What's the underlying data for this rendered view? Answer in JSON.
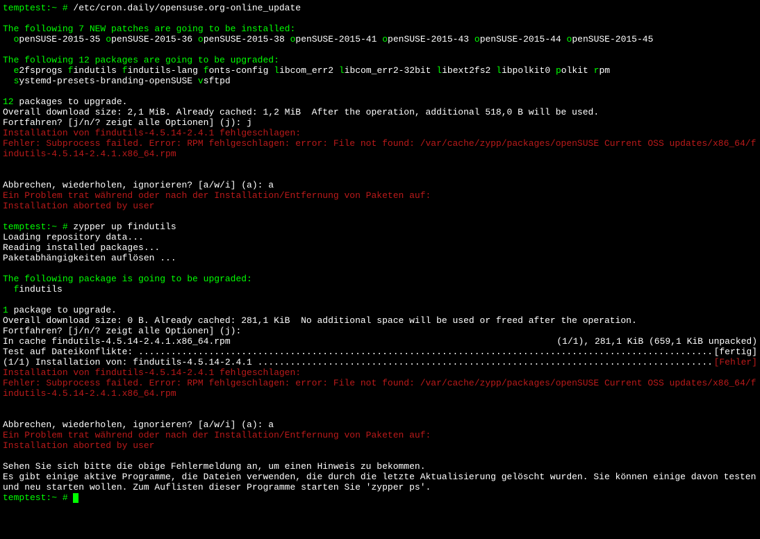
{
  "prompt1": {
    "host": "temptest:~ # ",
    "cmd": "/etc/cron.daily/opensuse.org-online_update"
  },
  "blank": "",
  "patches_header": "The following 7 NEW patches are going to be installed:",
  "patches": [
    "openSUSE-2015-35",
    "openSUSE-2015-36",
    "openSUSE-2015-38",
    "openSUSE-2015-41",
    "openSUSE-2015-43",
    "openSUSE-2015-44",
    "openSUSE-2015-45"
  ],
  "upgrades_header": "The following 12 packages are going to be upgraded:",
  "upgrades": [
    "e2fsprogs",
    "findutils",
    "findutils-lang",
    "fonts-config",
    "libcom_err2",
    "libcom_err2-32bit",
    "libext2fs2",
    "libpolkit0",
    "polkit",
    "rpm",
    "systemd-presets-branding-openSUSE",
    "vsftpd"
  ],
  "summary12": {
    "count": "12",
    "rest": " packages to upgrade."
  },
  "download1": "Overall download size: 2,1 MiB. Already cached: 1,2 MiB  After the operation, additional 518,0 B will be used.",
  "fortfahren1": "Fortfahren? [j/n/? zeigt alle Optionen] (j): j",
  "fail1a": "Installation von findutils-4.5.14-2.4.1 fehlgeschlagen:",
  "fail1b": "Fehler: Subprocess failed. Error: RPM fehlgeschlagen: error: File not found: /var/cache/zypp/packages/openSUSE Current OSS updates/x86_64/findutils-4.5.14-2.4.1.x86_64.rpm",
  "abbrechen": "Abbrechen, wiederholen, ignorieren? [a/w/i] (a): a",
  "problem": "Ein Problem trat während oder nach der Installation/Entfernung von Paketen auf:",
  "aborted": "Installation aborted by user",
  "prompt2": {
    "host": "temptest:~ # ",
    "cmd": "zypper up findutils"
  },
  "loading": "Loading repository data...",
  "reading": "Reading installed packages...",
  "resolve": "Paketabhängigkeiten auflösen ...",
  "upgrades_header2": "The following package is going to be upgraded:",
  "upgrades2": [
    "findutils"
  ],
  "summary1": {
    "count": "1",
    "rest": " package to upgrade."
  },
  "download2": "Overall download size: 0 B. Already cached: 281,1 KiB  No additional space will be used or freed after the operation.",
  "fortfahren2": "Fortfahren? [j/n/? zeigt alle Optionen] (j):",
  "cache_left": "In cache findutils-4.5.14-2.4.1.x86_64.rpm",
  "cache_right": "(1/1), 281,1 KiB (659,1 KiB unpacked)",
  "test_left": "Test auf Dateikonflikte: ",
  "test_dots": "..............................................................................................................................",
  "fertig": "[fertig]",
  "inst_left": "(1/1) Installation von: findutils-4.5.14-2.4.1 ",
  "inst_dots": ".........................................................................................................",
  "fehler": "[Fehler]",
  "note1": "Sehen Sie sich bitte die obige Fehlermeldung an, um einen Hinweis zu bekommen.",
  "note2": "Es gibt einige aktive Programme, die Dateien verwenden, die durch die letzte Aktualisierung gelöscht wurden. Sie können einige davon testen und neu starten wollen. Zum Auflisten dieser Programme starten Sie 'zypper ps'.",
  "prompt3": {
    "host": "temptest:~ # "
  }
}
